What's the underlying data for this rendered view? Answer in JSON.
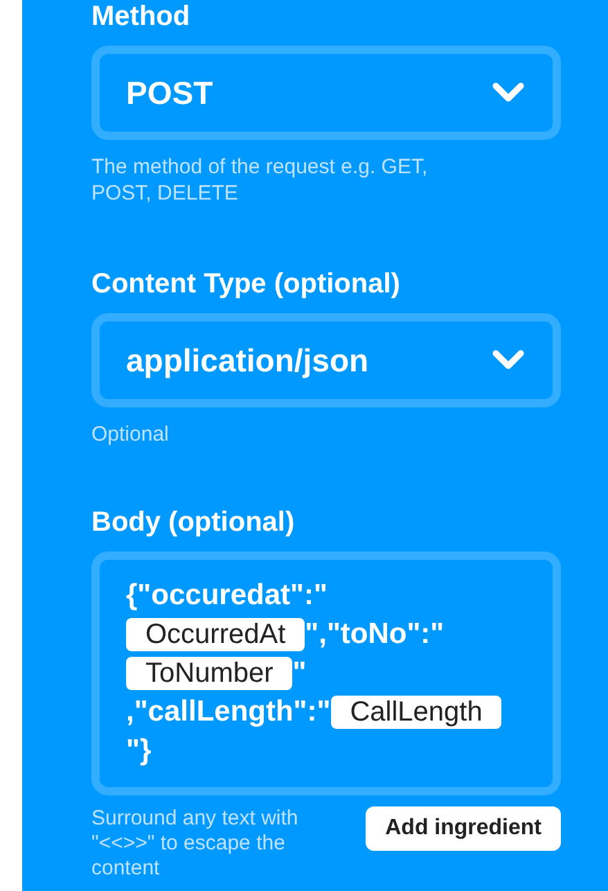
{
  "fields": [
    {
      "kind": "select",
      "label": "Method",
      "value": "POST",
      "help": "The method of the request e.g. GET, POST, DELETE"
    },
    {
      "kind": "select",
      "label": "Content Type (optional)",
      "value": "application/json",
      "help": "Optional"
    },
    {
      "kind": "body",
      "label": "Body (optional)",
      "lines": [
        [
          {
            "kind": "text",
            "text": "{\"occuredat\":\""
          }
        ],
        [
          {
            "kind": "ingredient",
            "text": "OccurredAt"
          },
          {
            "kind": "text",
            "text": "\",\"toNo\":\""
          }
        ],
        [
          {
            "kind": "ingredient",
            "text": "ToNumber"
          },
          {
            "kind": "text",
            "text": "\""
          }
        ],
        [
          {
            "kind": "text",
            "text": ",\"callLength\":\""
          },
          {
            "kind": "ingredient",
            "text": "CallLength"
          }
        ],
        [
          {
            "kind": "text",
            "text": "\"}"
          }
        ]
      ],
      "help": "Surround any text with \"<<>>\" to escape the content",
      "button": "Add ingredient"
    }
  ]
}
